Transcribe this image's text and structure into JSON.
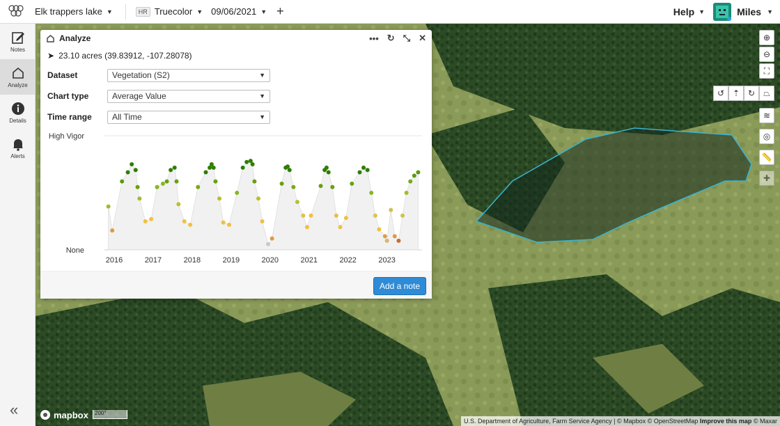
{
  "topbar": {
    "project": "Elk trappers lake",
    "resolution_badge": "HR",
    "layer": "Truecolor",
    "date": "09/06/2021",
    "help": "Help",
    "user": "Miles"
  },
  "sidebar": {
    "items": [
      {
        "label": "Notes",
        "icon": "notes-icon"
      },
      {
        "label": "Analyze",
        "icon": "analyze-icon"
      },
      {
        "label": "Details",
        "icon": "info-icon"
      },
      {
        "label": "Alerts",
        "icon": "bell-icon"
      }
    ]
  },
  "panel": {
    "title": "Analyze",
    "location": "23.10 acres (39.83912, -107.28078)",
    "fields": [
      {
        "label": "Dataset",
        "value": "Vegetation (S2)"
      },
      {
        "label": "Chart type",
        "value": "Average Value"
      },
      {
        "label": "Time range",
        "value": "All Time"
      }
    ],
    "add_note": "Add a note"
  },
  "chart_data": {
    "type": "scatter",
    "ylabels": [
      "High Vigor",
      "None"
    ],
    "x_ticks": [
      "2016",
      "2017",
      "2018",
      "2019",
      "2020",
      "2021",
      "2022",
      "2023"
    ],
    "xlim": [
      2015.75,
      2023.9
    ],
    "ylim": [
      0,
      1
    ],
    "series": [
      {
        "x": [
          2015.85,
          2015.95,
          2016.2,
          2016.35,
          2016.45,
          2016.55,
          2016.6,
          2016.65,
          2016.8,
          2016.95,
          2017.1,
          2017.25,
          2017.35,
          2017.45,
          2017.55,
          2017.6,
          2017.65,
          2017.8,
          2017.95,
          2018.15,
          2018.35,
          2018.45,
          2018.5,
          2018.55,
          2018.6,
          2018.7,
          2018.8,
          2018.95,
          2019.15,
          2019.3,
          2019.4,
          2019.5,
          2019.55,
          2019.6,
          2019.7,
          2019.8,
          2019.95,
          2020.05,
          2020.3,
          2020.4,
          2020.45,
          2020.5,
          2020.6,
          2020.7,
          2020.85,
          2020.95,
          2021.05,
          2021.3,
          2021.4,
          2021.45,
          2021.5,
          2021.6,
          2021.7,
          2021.8,
          2021.95,
          2022.1,
          2022.3,
          2022.4,
          2022.5,
          2022.6,
          2022.7,
          2022.8,
          2022.95,
          2023.0,
          2023.1,
          2023.2,
          2023.3,
          2023.4,
          2023.5,
          2023.6,
          2023.7,
          2023.8
        ],
        "y": [
          0.38,
          0.17,
          0.6,
          0.68,
          0.75,
          0.7,
          0.55,
          0.45,
          0.25,
          0.27,
          0.55,
          0.58,
          0.6,
          0.7,
          0.72,
          0.6,
          0.4,
          0.25,
          0.22,
          0.55,
          0.68,
          0.72,
          0.75,
          0.72,
          0.6,
          0.45,
          0.24,
          0.22,
          0.5,
          0.72,
          0.77,
          0.78,
          0.75,
          0.6,
          0.45,
          0.25,
          0.05,
          0.1,
          0.58,
          0.72,
          0.73,
          0.7,
          0.55,
          0.42,
          0.3,
          0.2,
          0.3,
          0.56,
          0.7,
          0.72,
          0.68,
          0.55,
          0.3,
          0.2,
          0.28,
          0.58,
          0.68,
          0.72,
          0.7,
          0.5,
          0.3,
          0.18,
          0.12,
          0.08,
          0.35,
          0.12,
          0.08,
          0.3,
          0.5,
          0.6,
          0.65,
          0.68
        ],
        "colors": [
          "#a8b830",
          "#e09a40",
          "#5a9a10",
          "#2e7d00",
          "#2e7d00",
          "#2e7d00",
          "#6aa010",
          "#a8b830",
          "#f0c040",
          "#f0c040",
          "#8ab520",
          "#8ab520",
          "#6aa010",
          "#2e7d00",
          "#2e7d00",
          "#6aa010",
          "#b8c030",
          "#f0c040",
          "#f0c040",
          "#7aaa18",
          "#2e7d00",
          "#2e7d00",
          "#2e7d00",
          "#2e7d00",
          "#6aa010",
          "#b8c030",
          "#f0c040",
          "#f0c040",
          "#8ab520",
          "#2e7d00",
          "#2e7d00",
          "#2e7d00",
          "#2e7d00",
          "#6aa010",
          "#b8c030",
          "#f0c040",
          "#c9c9c9",
          "#e09a40",
          "#6aa010",
          "#2e7d00",
          "#2e7d00",
          "#2e7d00",
          "#7aaa18",
          "#b8c030",
          "#e0c050",
          "#f0c040",
          "#f0c040",
          "#6aa010",
          "#2e7d00",
          "#2e7d00",
          "#2e7d00",
          "#6aa010",
          "#e0c050",
          "#f0c040",
          "#f0c040",
          "#6aa010",
          "#2e7d00",
          "#2e7d00",
          "#2e7d00",
          "#8ab520",
          "#e0c050",
          "#f0c040",
          "#e09a40",
          "#d9b370",
          "#d0c050",
          "#e09a40",
          "#c07030",
          "#d0c050",
          "#a8b830",
          "#7aaa18",
          "#5a9a10",
          "#5a9a10"
        ]
      }
    ]
  },
  "map": {
    "attribution_prefix": "U.S. Department of Agriculture, Farm Service Agency | © Mapbox © OpenStreetMap",
    "attribution_link": "Improve this map",
    "attribution_suffix": "© Maxar",
    "logo": "mapbox",
    "scale": "200°"
  }
}
